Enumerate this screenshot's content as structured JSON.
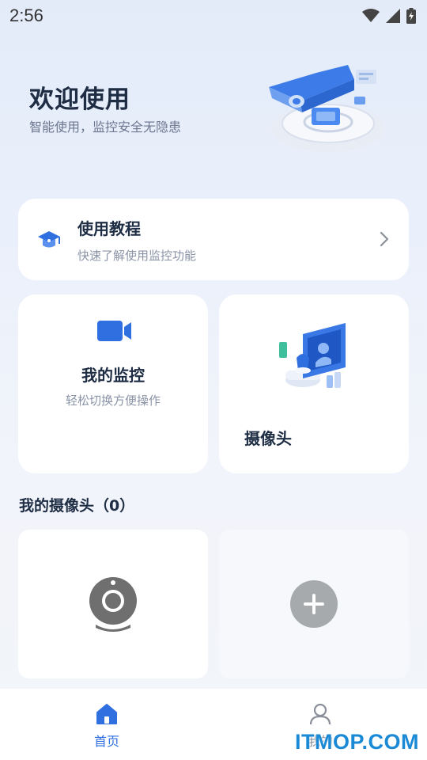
{
  "status_bar": {
    "time": "2:56",
    "icons": [
      "wifi-icon",
      "signal-icon",
      "battery-charging-icon"
    ]
  },
  "hero": {
    "title": "欢迎使用",
    "subtitle": "智能使用，监控安全无隐患",
    "illustration": "security-camera-illustration"
  },
  "tutorial": {
    "icon": "graduation-cap-icon",
    "title": "使用教程",
    "subtitle": "快速了解使用监控功能",
    "action_icon": "chevron-right-icon"
  },
  "my_monitor": {
    "icon": "video-camera-icon",
    "title": "我的监控",
    "subtitle": "轻松切换方便操作"
  },
  "camera": {
    "icon": "camera-screen-illustration",
    "title": "摄像头"
  },
  "my_cameras": {
    "title": "我的摄像头（0）",
    "device_icon": "webcam-icon",
    "add_icon": "plus-icon"
  },
  "tabs": [
    {
      "label": "首页",
      "icon": "home-icon",
      "active": true
    },
    {
      "label": "我的",
      "icon": "user-icon",
      "active": false
    }
  ],
  "watermark": "ITMOP.COM",
  "colors": {
    "accent": "#2f6fe0",
    "title_text": "#1e2d44",
    "muted_text": "#8a93a6",
    "watermark": "#1a89d6"
  }
}
